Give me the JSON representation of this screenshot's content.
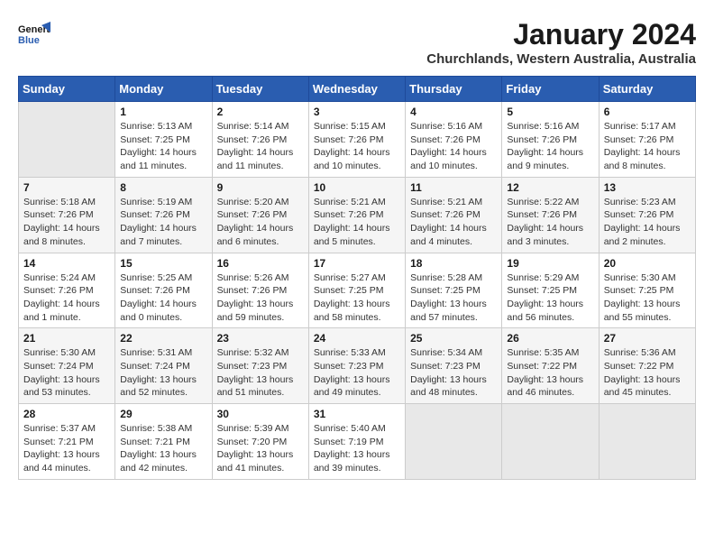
{
  "header": {
    "logo_line1": "General",
    "logo_line2": "Blue",
    "month_title": "January 2024",
    "location": "Churchlands, Western Australia, Australia"
  },
  "columns": [
    "Sunday",
    "Monday",
    "Tuesday",
    "Wednesday",
    "Thursday",
    "Friday",
    "Saturday"
  ],
  "weeks": [
    [
      {
        "day": "",
        "info": ""
      },
      {
        "day": "1",
        "info": "Sunrise: 5:13 AM\nSunset: 7:25 PM\nDaylight: 14 hours\nand 11 minutes."
      },
      {
        "day": "2",
        "info": "Sunrise: 5:14 AM\nSunset: 7:26 PM\nDaylight: 14 hours\nand 11 minutes."
      },
      {
        "day": "3",
        "info": "Sunrise: 5:15 AM\nSunset: 7:26 PM\nDaylight: 14 hours\nand 10 minutes."
      },
      {
        "day": "4",
        "info": "Sunrise: 5:16 AM\nSunset: 7:26 PM\nDaylight: 14 hours\nand 10 minutes."
      },
      {
        "day": "5",
        "info": "Sunrise: 5:16 AM\nSunset: 7:26 PM\nDaylight: 14 hours\nand 9 minutes."
      },
      {
        "day": "6",
        "info": "Sunrise: 5:17 AM\nSunset: 7:26 PM\nDaylight: 14 hours\nand 8 minutes."
      }
    ],
    [
      {
        "day": "7",
        "info": "Sunrise: 5:18 AM\nSunset: 7:26 PM\nDaylight: 14 hours\nand 8 minutes."
      },
      {
        "day": "8",
        "info": "Sunrise: 5:19 AM\nSunset: 7:26 PM\nDaylight: 14 hours\nand 7 minutes."
      },
      {
        "day": "9",
        "info": "Sunrise: 5:20 AM\nSunset: 7:26 PM\nDaylight: 14 hours\nand 6 minutes."
      },
      {
        "day": "10",
        "info": "Sunrise: 5:21 AM\nSunset: 7:26 PM\nDaylight: 14 hours\nand 5 minutes."
      },
      {
        "day": "11",
        "info": "Sunrise: 5:21 AM\nSunset: 7:26 PM\nDaylight: 14 hours\nand 4 minutes."
      },
      {
        "day": "12",
        "info": "Sunrise: 5:22 AM\nSunset: 7:26 PM\nDaylight: 14 hours\nand 3 minutes."
      },
      {
        "day": "13",
        "info": "Sunrise: 5:23 AM\nSunset: 7:26 PM\nDaylight: 14 hours\nand 2 minutes."
      }
    ],
    [
      {
        "day": "14",
        "info": "Sunrise: 5:24 AM\nSunset: 7:26 PM\nDaylight: 14 hours\nand 1 minute."
      },
      {
        "day": "15",
        "info": "Sunrise: 5:25 AM\nSunset: 7:26 PM\nDaylight: 14 hours\nand 0 minutes."
      },
      {
        "day": "16",
        "info": "Sunrise: 5:26 AM\nSunset: 7:26 PM\nDaylight: 13 hours\nand 59 minutes."
      },
      {
        "day": "17",
        "info": "Sunrise: 5:27 AM\nSunset: 7:25 PM\nDaylight: 13 hours\nand 58 minutes."
      },
      {
        "day": "18",
        "info": "Sunrise: 5:28 AM\nSunset: 7:25 PM\nDaylight: 13 hours\nand 57 minutes."
      },
      {
        "day": "19",
        "info": "Sunrise: 5:29 AM\nSunset: 7:25 PM\nDaylight: 13 hours\nand 56 minutes."
      },
      {
        "day": "20",
        "info": "Sunrise: 5:30 AM\nSunset: 7:25 PM\nDaylight: 13 hours\nand 55 minutes."
      }
    ],
    [
      {
        "day": "21",
        "info": "Sunrise: 5:30 AM\nSunset: 7:24 PM\nDaylight: 13 hours\nand 53 minutes."
      },
      {
        "day": "22",
        "info": "Sunrise: 5:31 AM\nSunset: 7:24 PM\nDaylight: 13 hours\nand 52 minutes."
      },
      {
        "day": "23",
        "info": "Sunrise: 5:32 AM\nSunset: 7:23 PM\nDaylight: 13 hours\nand 51 minutes."
      },
      {
        "day": "24",
        "info": "Sunrise: 5:33 AM\nSunset: 7:23 PM\nDaylight: 13 hours\nand 49 minutes."
      },
      {
        "day": "25",
        "info": "Sunrise: 5:34 AM\nSunset: 7:23 PM\nDaylight: 13 hours\nand 48 minutes."
      },
      {
        "day": "26",
        "info": "Sunrise: 5:35 AM\nSunset: 7:22 PM\nDaylight: 13 hours\nand 46 minutes."
      },
      {
        "day": "27",
        "info": "Sunrise: 5:36 AM\nSunset: 7:22 PM\nDaylight: 13 hours\nand 45 minutes."
      }
    ],
    [
      {
        "day": "28",
        "info": "Sunrise: 5:37 AM\nSunset: 7:21 PM\nDaylight: 13 hours\nand 44 minutes."
      },
      {
        "day": "29",
        "info": "Sunrise: 5:38 AM\nSunset: 7:21 PM\nDaylight: 13 hours\nand 42 minutes."
      },
      {
        "day": "30",
        "info": "Sunrise: 5:39 AM\nSunset: 7:20 PM\nDaylight: 13 hours\nand 41 minutes."
      },
      {
        "day": "31",
        "info": "Sunrise: 5:40 AM\nSunset: 7:19 PM\nDaylight: 13 hours\nand 39 minutes."
      },
      {
        "day": "",
        "info": ""
      },
      {
        "day": "",
        "info": ""
      },
      {
        "day": "",
        "info": ""
      }
    ]
  ]
}
